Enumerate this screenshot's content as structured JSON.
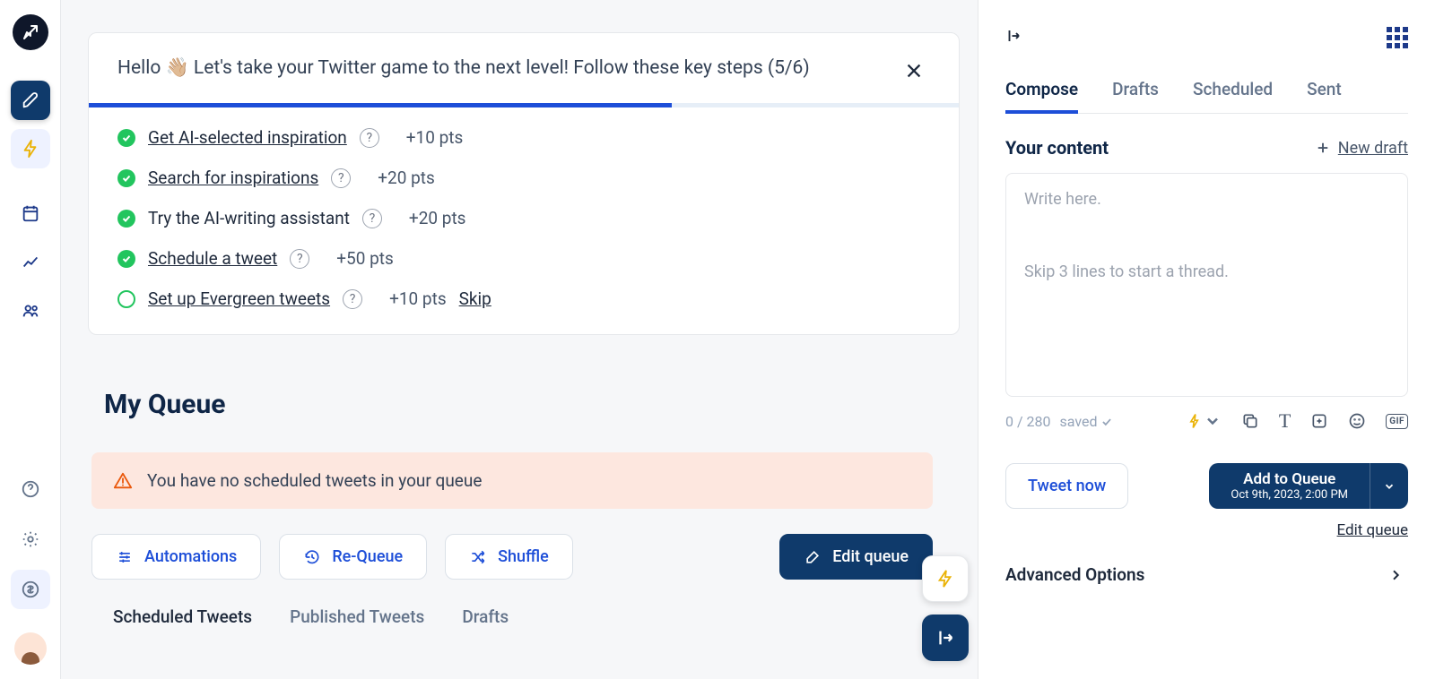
{
  "onboard": {
    "greeting_prefix": "Hello ",
    "greeting_rest": " Let's take your Twitter game to the next level! Follow these key steps (5/6)",
    "progress_pct": 67,
    "steps": [
      {
        "label": "Get AI-selected inspiration",
        "pts": "+10 pts",
        "done": true,
        "link": true
      },
      {
        "label": "Search for inspirations",
        "pts": "+20 pts",
        "done": true,
        "link": true
      },
      {
        "label": "Try the AI-writing assistant",
        "pts": "+20 pts",
        "done": true,
        "link": false
      },
      {
        "label": "Schedule a tweet",
        "pts": "+50 pts",
        "done": true,
        "link": true
      },
      {
        "label": "Set up Evergreen tweets",
        "pts": "+10 pts",
        "done": false,
        "link": true,
        "skip": "Skip"
      }
    ]
  },
  "queue": {
    "title": "My Queue",
    "alert": "You have no scheduled tweets in your queue",
    "buttons": {
      "automations": "Automations",
      "requeue": "Re-Queue",
      "shuffle": "Shuffle",
      "edit": "Edit queue"
    },
    "subtabs": [
      "Scheduled Tweets",
      "Published Tweets",
      "Drafts"
    ]
  },
  "compose": {
    "tabs": [
      "Compose",
      "Drafts",
      "Scheduled",
      "Sent"
    ],
    "content_heading": "Your content",
    "new_draft": "New draft",
    "placeholder1": "Write here.",
    "placeholder2": "Skip 3 lines to start a thread.",
    "counter": "0 / 280",
    "saved": "saved",
    "tweet_now": "Tweet now",
    "add_queue": "Add to Queue",
    "add_queue_sub": "Oct 9th, 2023, 2:00 PM",
    "edit_queue": "Edit queue",
    "advanced": "Advanced Options"
  }
}
